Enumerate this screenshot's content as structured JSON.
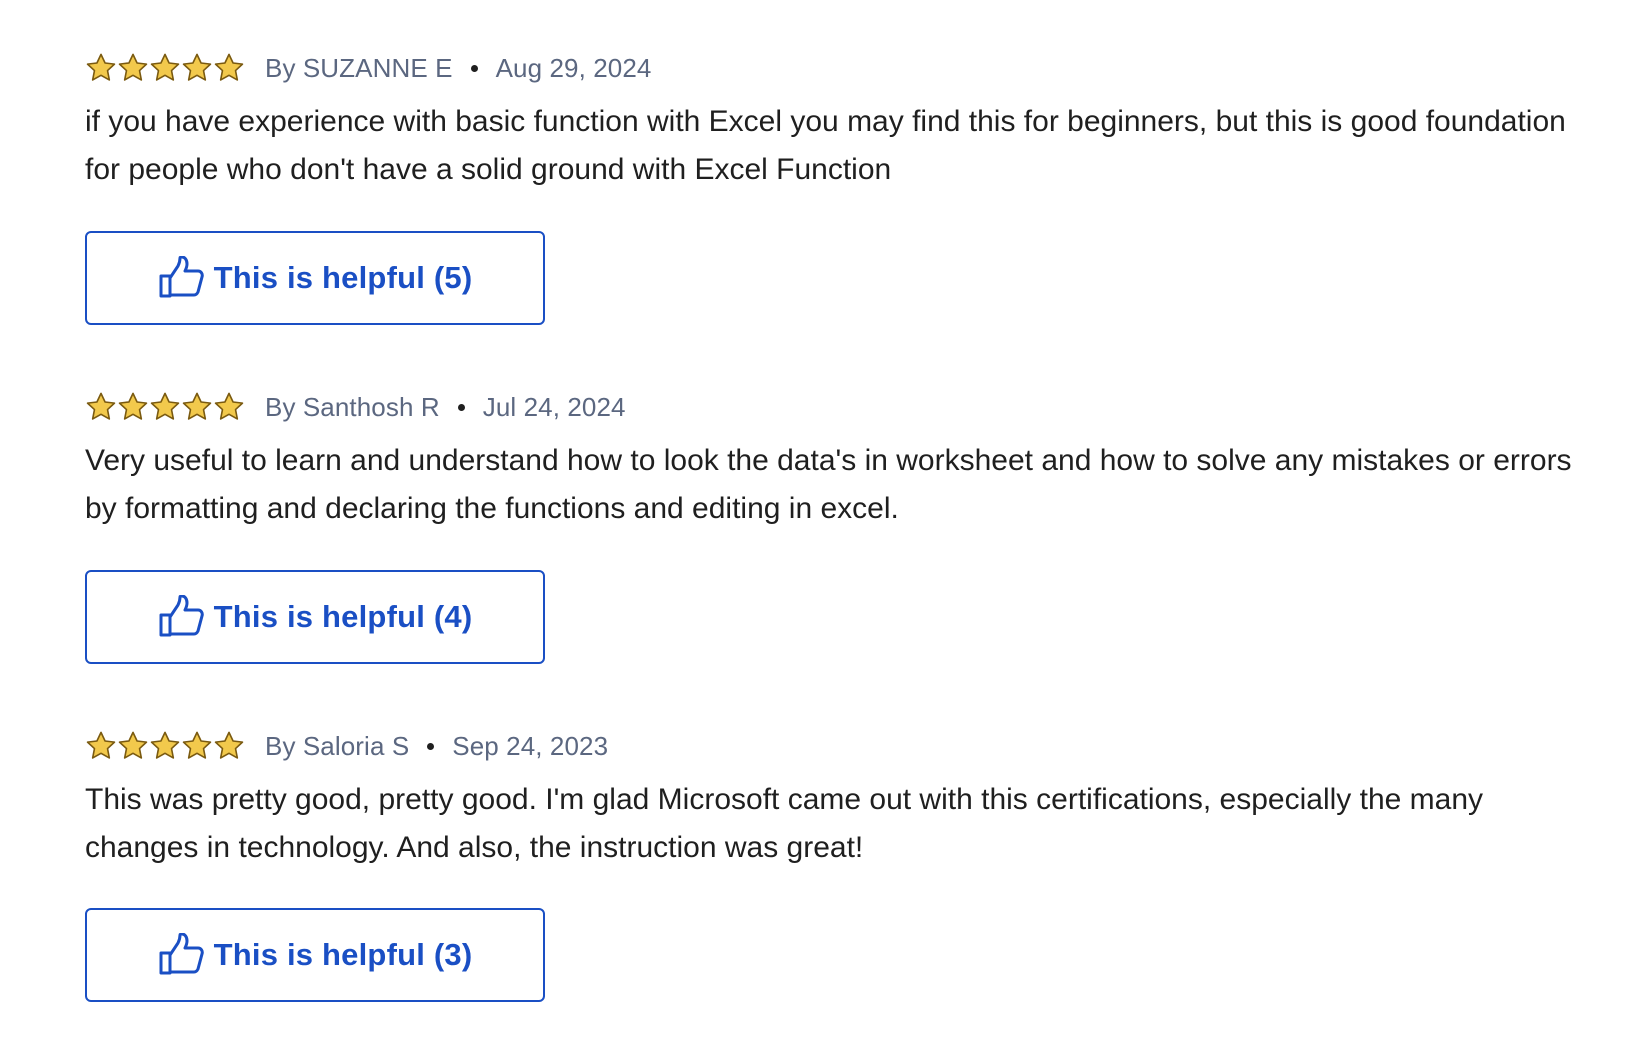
{
  "colors": {
    "star_fill": "#f2c94c",
    "star_stroke": "#7a5a10",
    "accent": "#1a4fc4",
    "meta_text": "#5b6780",
    "body_text": "#1f1f1f"
  },
  "reviews": [
    {
      "rating": 5,
      "author": "By SUZANNE E",
      "date": "Aug 29, 2024",
      "text": "if you have experience with basic function with Excel you may find this for beginners, but this is good foundation for people who don't have a solid ground with Excel Function",
      "helpful_label": "This is helpful (5)"
    },
    {
      "rating": 5,
      "author": "By Santhosh R",
      "date": "Jul 24, 2024",
      "text": "Very useful to learn and understand how to look the data's in worksheet and how to solve any mistakes or errors by formatting and declaring the functions and editing in excel.",
      "helpful_label": "This is helpful (4)"
    },
    {
      "rating": 5,
      "author": "By Saloria S",
      "date": "Sep 24, 2023",
      "text": "This was pretty good, pretty good. I'm glad Microsoft came out with this certifications, especially the many changes in technology. And also, the instruction was great!",
      "helpful_label": "This is helpful (3)"
    }
  ]
}
